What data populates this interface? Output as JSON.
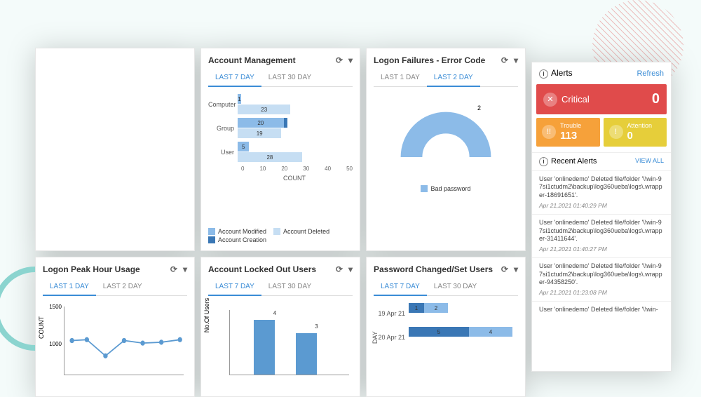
{
  "colors": {
    "modified": "#8cbbe8",
    "deleted": "#c6def3",
    "creation": "#3a77b5",
    "bar": "#5b9ad1"
  },
  "cards": {
    "account_mgmt": {
      "title": "Account Management",
      "tabs": [
        "LAST 7 DAY",
        "LAST 30 DAY"
      ],
      "active_tab": 0,
      "xlabel": "COUNT",
      "legend": [
        "Account Modified",
        "Account Deleted",
        "Account Creation"
      ]
    },
    "logon_fail": {
      "title": "Logon Failures - Error Code",
      "tabs": [
        "LAST 1 DAY",
        "LAST 2 DAY"
      ],
      "active_tab": 1,
      "legend": [
        "Bad password"
      ]
    },
    "peak": {
      "title": "Logon Peak Hour Usage",
      "tabs": [
        "LAST 1 DAY",
        "LAST 2 DAY"
      ],
      "active_tab": 0,
      "ylabel": "COUNT"
    },
    "locked": {
      "title": "Account Locked Out Users",
      "tabs": [
        "LAST 7 DAY",
        "LAST 30 DAY"
      ],
      "active_tab": 0,
      "ylabel": "No.Of Users"
    },
    "password": {
      "title": "Password Changed/Set Users",
      "tabs": [
        "LAST 7 DAY",
        "LAST 30 DAY"
      ],
      "active_tab": 0,
      "ylabel": "DAY"
    }
  },
  "chart_data": [
    {
      "id": "account_mgmt",
      "type": "bar",
      "orientation": "horizontal",
      "categories": [
        "Computer",
        "Group",
        "User"
      ],
      "series": [
        {
          "name": "Account Modified",
          "values": [
            1,
            20,
            5
          ]
        },
        {
          "name": "Account Deleted",
          "values": [
            23,
            19,
            28
          ]
        },
        {
          "name": "Account Creation",
          "values": [
            null,
            1,
            null
          ]
        }
      ],
      "xlabel": "COUNT",
      "xlim": [
        0,
        50
      ],
      "xticks": [
        0,
        10,
        20,
        30,
        40,
        50
      ]
    },
    {
      "id": "logon_fail",
      "type": "pie_half",
      "categories": [
        "Bad password"
      ],
      "values": [
        2
      ],
      "title": "Logon Failures - Error Code"
    },
    {
      "id": "peak",
      "type": "line",
      "x": [
        1,
        2,
        3,
        4,
        5,
        6,
        7
      ],
      "values": [
        1000,
        1020,
        760,
        1000,
        970,
        980,
        1020
      ],
      "ylabel": "COUNT",
      "yticks": [
        1000,
        1500
      ]
    },
    {
      "id": "locked",
      "type": "bar",
      "categories": [
        "",
        ""
      ],
      "values": [
        4,
        3
      ],
      "ylabel": "No.Of Users"
    },
    {
      "id": "password",
      "type": "bar",
      "orientation": "horizontal",
      "categories": [
        "19 Apr 21",
        "20 Apr 21"
      ],
      "series": [
        {
          "name": "s1",
          "values": [
            1,
            5
          ]
        },
        {
          "name": "s2",
          "values": [
            2,
            4
          ]
        }
      ],
      "ylabel": "DAY"
    }
  ],
  "sidebar": {
    "title": "Alerts",
    "refresh": "Refresh",
    "critical": {
      "label": "Critical",
      "count": 0
    },
    "trouble": {
      "label": "Trouble",
      "count": 113
    },
    "attention": {
      "label": "Attention",
      "count": 0
    },
    "recent_title": "Recent Alerts",
    "viewall": "VIEW ALL",
    "items": [
      {
        "text": "User 'onlinedemo' Deleted file/folder '\\\\win-97si1ctudm2\\backup\\log360ueba\\logs\\.wrapper-18691651'.",
        "time": "Apr 21,2021 01:40:29 PM"
      },
      {
        "text": "User 'onlinedemo' Deleted file/folder '\\\\win-97si1ctudm2\\backup\\log360ueba\\logs\\.wrapper-31411644'.",
        "time": "Apr 21,2021 01:40:27 PM"
      },
      {
        "text": "User 'onlinedemo' Deleted file/folder '\\\\win-97si1ctudm2\\backup\\log360ueba\\logs\\.wrapper-94358250'.",
        "time": "Apr 21,2021 01:23:08 PM"
      },
      {
        "text": "User 'onlinedemo' Deleted file/folder '\\\\win-",
        "time": ""
      }
    ]
  }
}
